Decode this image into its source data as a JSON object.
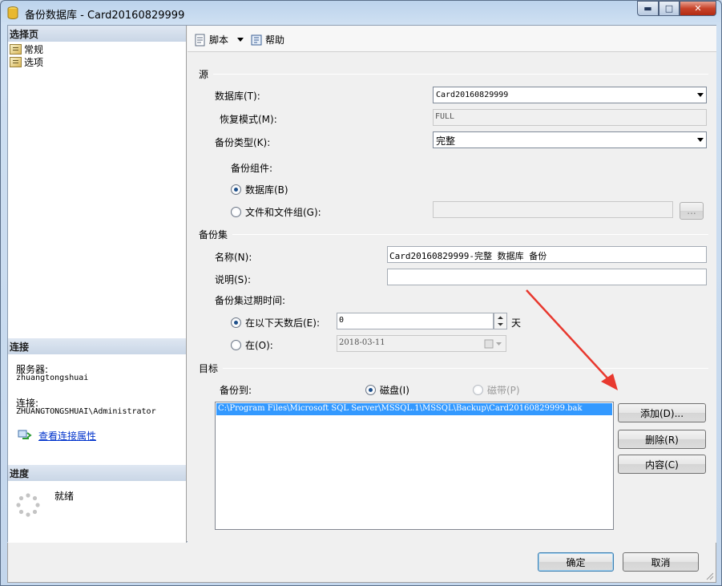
{
  "window": {
    "title": "备份数据库 - Card20160829999",
    "buttons": {
      "minimize": "▬",
      "maximize": "□",
      "close": "✕"
    }
  },
  "left": {
    "select_page_header": "选择页",
    "nav": [
      {
        "label": "常规"
      },
      {
        "label": "选项"
      }
    ],
    "connection_header": "连接",
    "server_label": "服务器:",
    "server_value": "zhuangtongshuai",
    "conn_label": "连接:",
    "conn_value": "ZHUANGTONGSHUAI\\Administrator",
    "view_conn_link": "查看连接属性",
    "progress_header": "进度",
    "progress_status": "就绪"
  },
  "toolbar": {
    "script_label": "脚本",
    "help_label": "帮助"
  },
  "source": {
    "header": "源",
    "database_label": "数据库(T):",
    "database_value": "Card20160829999",
    "recovery_label": "恢复模式(M):",
    "recovery_value": "FULL",
    "backup_type_label": "备份类型(K):",
    "backup_type_value": "完整",
    "component_label": "备份组件:",
    "component_db": "数据库(B)",
    "component_files": "文件和文件组(G):",
    "browse_label": "..."
  },
  "backup_set": {
    "header": "备份集",
    "name_label": "名称(N):",
    "name_value": "Card20160829999-完整 数据库 备份",
    "desc_label": "说明(S):",
    "desc_value": "",
    "expire_label": "备份集过期时间:",
    "after_days_label": "在以下天数后(E):",
    "after_days_value": "0",
    "days_unit": "天",
    "on_label": "在(O):",
    "on_value": "2018-03-11"
  },
  "destination": {
    "header": "目标",
    "backup_to_label": "备份到:",
    "disk_label": "磁盘(I)",
    "tape_label": "磁带(P)",
    "paths": [
      "C:\\Program Files\\Microsoft SQL Server\\MSSQL.1\\MSSQL\\Backup\\Card20160829999.bak"
    ],
    "add_label": "添加(D)...",
    "remove_label": "删除(R)",
    "contents_label": "内容(C)"
  },
  "footer": {
    "ok_label": "确定",
    "cancel_label": "取消"
  },
  "colors": {
    "selection": "#3399ff",
    "annotation_arrow": "#e8392f"
  }
}
